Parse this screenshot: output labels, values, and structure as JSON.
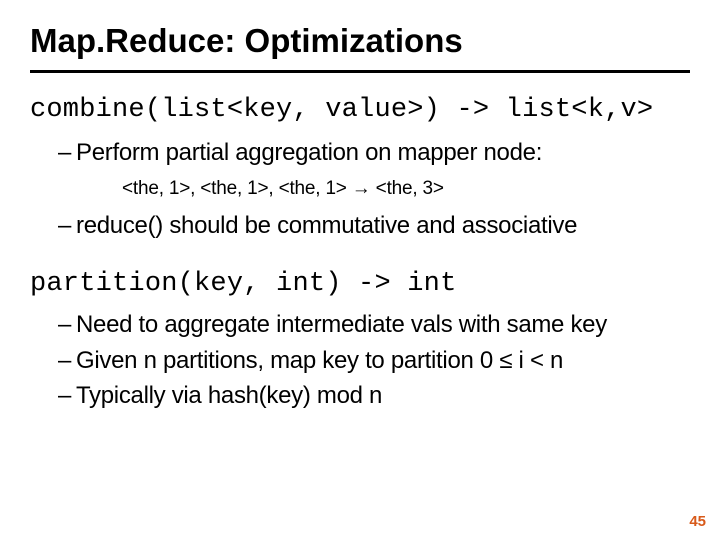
{
  "title": "Map.Reduce:  Optimizations",
  "combine": {
    "signature": "combine(list<key, value>) -> list<k,v>",
    "b1": "Perform partial aggregation on mapper node:",
    "example_left": "<the, 1>, <the, 1>, <the, 1> ",
    "arrow": "→",
    "example_right": "   <the, 3>",
    "b2": "reduce() should be commutative and associative"
  },
  "partition": {
    "signature": "partition(key, int) -> int",
    "b1": "Need to aggregate intermediate vals with same key",
    "b2": "Given n partitions, map key to partition 0 ≤ i < n",
    "b3": "Typically via hash(key) mod n"
  },
  "page": "45"
}
